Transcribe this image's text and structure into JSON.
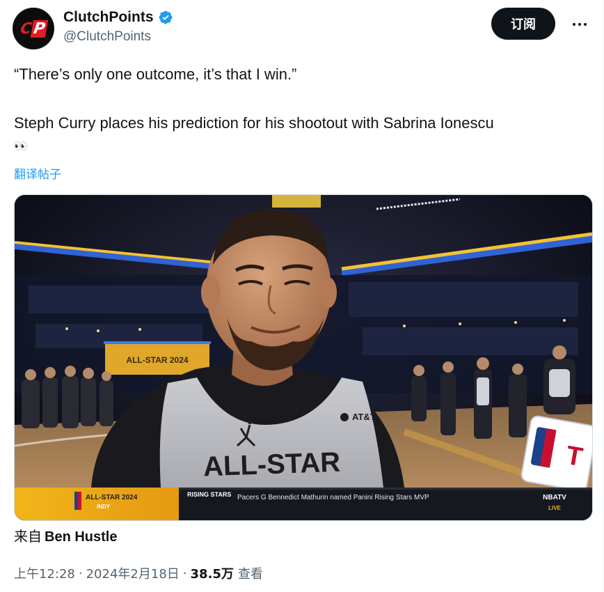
{
  "author": {
    "display_name": "ClutchPoints",
    "handle": "@ClutchPoints",
    "avatar_icon": "clutchpoints-cp-logo",
    "avatar_letters": {
      "c": "C",
      "p": "P"
    },
    "verified_icon": "verified-badge-icon",
    "verified_color": "#1d9bf0"
  },
  "actions": {
    "subscribe_label": "订阅",
    "more_icon": "more-horizontal-icon"
  },
  "tweet": {
    "line1": "“There’s only one outcome, it’s that I win.”",
    "line2": "Steph Curry places his prediction for his shootout with Sabrina Ionescu",
    "emoji": "👀",
    "translate_label": "翻译帖子"
  },
  "media": {
    "type": "video-still",
    "description_icon": "basketball-player-interview-image",
    "jersey_text": "ALL-STAR",
    "sponsor_text": "AT&T",
    "scoreboard_text": "ALL-STAR 2024",
    "ticker": {
      "badge_line1": "ALL-STAR 2024",
      "badge_line2": "INDY",
      "category": "RISING STARS",
      "headline": "Pacers G Bennedict Mathurin named Panini Rising Stars MVP",
      "network": "NBATV",
      "live_label": "LIVE"
    },
    "mic_flag_text": "T"
  },
  "attribution": {
    "prefix": "来自",
    "name": "Ben Hustle"
  },
  "meta": {
    "time": "上午12:28",
    "separator": "·",
    "date": "2024年2月18日",
    "views_count": "38.5万",
    "views_label": "查看"
  }
}
